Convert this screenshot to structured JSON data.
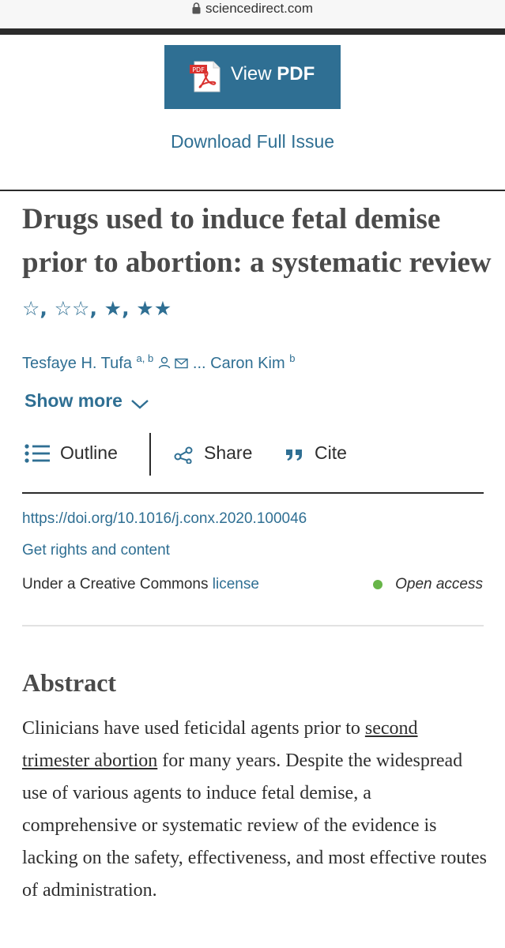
{
  "browser": {
    "url": "sciencedirect.com"
  },
  "actions": {
    "view_pdf_prefix": "View",
    "view_pdf_bold": "PDF",
    "pdf_icon_text": "PDF",
    "download_issue": "Download Full Issue"
  },
  "article": {
    "title_text": "Drugs used to induce fetal demise prior to abortion: a systematic review",
    "stars": [
      {
        "symbol": "☆",
        "sep": ", "
      },
      {
        "symbol": "☆☆",
        "sep": ", "
      },
      {
        "symbol": "★",
        "sep": ", "
      },
      {
        "symbol": "★★",
        "sep": ""
      }
    ],
    "author1": "Tesfaye H. Tufa",
    "author1_sup": "a, b",
    "ellipsis": "...",
    "author2": "Caron Kim",
    "author2_sup": "b",
    "show_more": "Show more"
  },
  "toolbar": {
    "outline": "Outline",
    "share": "Share",
    "cite": "Cite"
  },
  "meta": {
    "doi": "https://doi.org/10.1016/j.conx.2020.100046",
    "rights": "Get rights and content",
    "license_prefix": "Under a Creative Commons",
    "license_link": "license",
    "open_access": "Open access"
  },
  "abstract": {
    "heading": "Abstract",
    "text_1": "Clinicians have used feticidal agents prior to",
    "link_text": "second trimester abortion",
    "text_2": "for many years. Despite the widespread use of various agents to induce fetal demise, a comprehensive or systematic review of the evidence is lacking on the safety, effectiveness, and most effective routes of administration."
  },
  "colors": {
    "accent": "#2f6f93",
    "open_access_dot": "#67b548",
    "text": "#2e2e2e"
  }
}
